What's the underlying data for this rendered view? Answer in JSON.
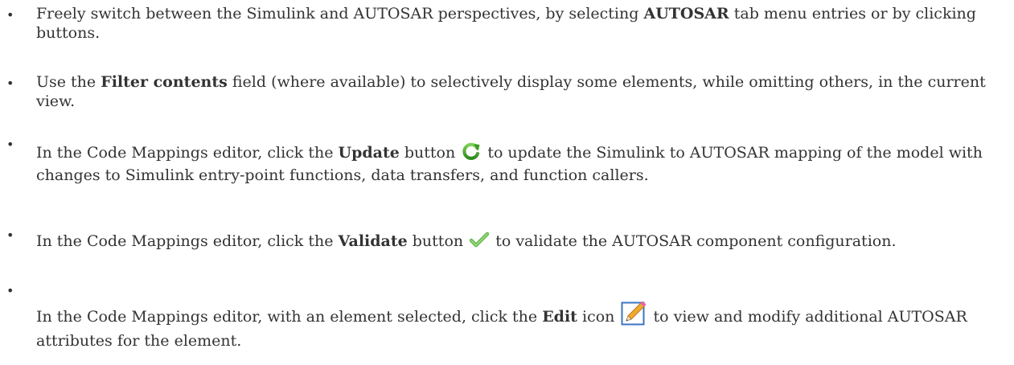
{
  "items": [
    {
      "p1": "Freely switch between the Simulink and AUTOSAR perspectives, by selecting ",
      "b1": "AUTOSAR",
      "p2": " tab menu entries or by clicking buttons."
    },
    {
      "p1": "Use the ",
      "b1": "Filter contents",
      "p2": " field (where available) to selectively display some elements, while omitting others, in the current view."
    },
    {
      "p1": "In the Code Mappings editor, click the ",
      "b1": "Update",
      "p2": " button",
      "icon": "update-arrow-icon",
      "p3": " to update the Simulink to AUTOSAR mapping of the model with changes to Simulink entry-point functions, data transfers, and function callers."
    },
    {
      "p1": "In the Code Mappings editor, click the ",
      "b1": "Validate",
      "p2": " button",
      "icon": "checkmark-icon",
      "p3": " to validate the AUTOSAR component configuration."
    },
    {
      "p1": "In the Code Mappings editor, with an element selected, click the ",
      "b1": "Edit",
      "p2": " icon",
      "icon": "pencil-edit-icon",
      "p3": " to view and modify additional AUTOSAR attributes for the element."
    }
  ]
}
